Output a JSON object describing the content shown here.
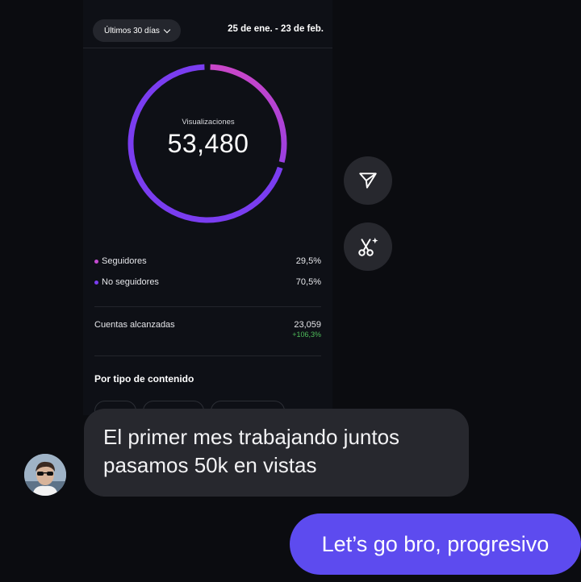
{
  "insights": {
    "period_label": "Últimos 30 días",
    "date_range": "25 de ene. - 23 de feb.",
    "donut": {
      "label": "Visualizaciones",
      "value": "53,480",
      "segments": [
        {
          "name": "Seguidores",
          "pct": "29,5%",
          "fraction": 0.295,
          "color": "#c34ad0"
        },
        {
          "name": "No seguidores",
          "pct": "70,5%",
          "fraction": 0.705,
          "color": "#7a3df0"
        }
      ]
    },
    "legend": [
      {
        "label": "Seguidores",
        "value": "29,5%",
        "color": "#c34ad0"
      },
      {
        "label": "No seguidores",
        "value": "70,5%",
        "color": "#7a3df0"
      }
    ],
    "reach": {
      "label": "Cuentas alcanzadas",
      "value": "23,059",
      "change": "+106,3%"
    },
    "section_title": "Por tipo de contenido"
  },
  "actions": {
    "share_icon": "paper-plane-icon",
    "edit_icon": "scissors-sparkle-icon"
  },
  "chat": {
    "incoming": "El primer mes trabajando juntos pasamos 50k en vistas",
    "outgoing": "Let’s go bro, progresivo"
  },
  "colors": {
    "outgoing_bubble": "#5d4bef",
    "incoming_bubble": "#27282e",
    "positive_change": "#4fbe5b"
  }
}
